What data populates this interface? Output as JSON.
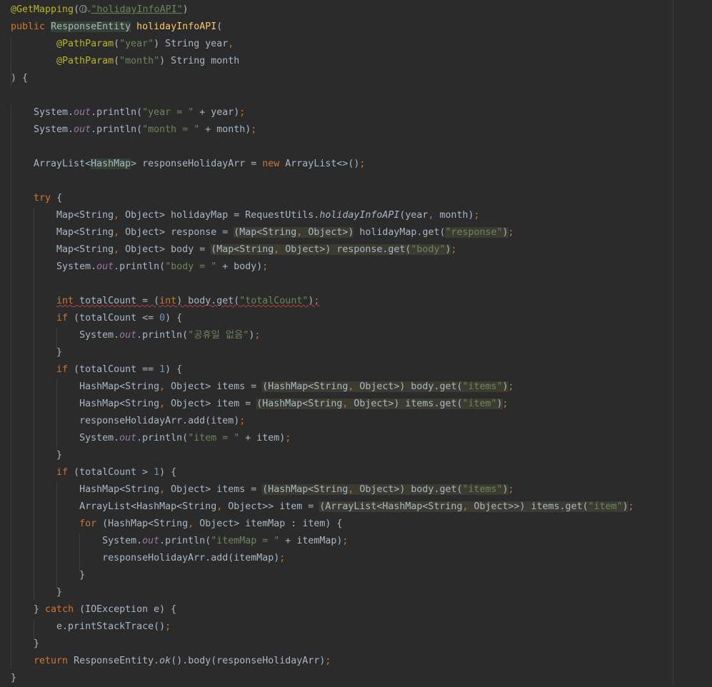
{
  "editor": {
    "lines": [
      "@GetMapping(\"holidayInfoAPI\")",
      "public ResponseEntity holidayInfoAPI(",
      "        @PathParam(\"year\") String year,",
      "        @PathParam(\"month\") String month",
      ") {",
      "",
      "    System.out.println(\"year = \" + year);",
      "    System.out.println(\"month = \" + month);",
      "",
      "    ArrayList<HashMap> responseHolidayArr = new ArrayList<>();",
      "",
      "    try {",
      "        Map<String, Object> holidayMap = RequestUtils.holidayInfoAPI(year, month);",
      "        Map<String, Object> response = (Map<String, Object>) holidayMap.get(\"response\");",
      "        Map<String, Object> body = (Map<String, Object>) response.get(\"body\");",
      "        System.out.println(\"body = \" + body);",
      "",
      "        int totalCount = (int) body.get(\"totalCount\");",
      "        if (totalCount <= 0) {",
      "            System.out.println(\"공휴일 없음\");",
      "        }",
      "        if (totalCount == 1) {",
      "            HashMap<String, Object> items = (HashMap<String, Object>) body.get(\"items\");",
      "            HashMap<String, Object> item = (HashMap<String, Object>) items.get(\"item\");",
      "            responseHolidayArr.add(item);",
      "            System.out.println(\"item = \" + item);",
      "        }",
      "        if (totalCount > 1) {",
      "            HashMap<String, Object> items = (HashMap<String, Object>) body.get(\"items\");",
      "            ArrayList<HashMap<String, Object>> item = (ArrayList<HashMap<String, Object>>) items.get(\"item\");",
      "            for (HashMap<String, Object> itemMap : item) {",
      "                System.out.println(\"itemMap = \" + itemMap);",
      "                responseHolidayArr.add(itemMap);",
      "            }",
      "        }",
      "    } catch (IOException e) {",
      "        e.printStackTrace();",
      "    }",
      "    return ResponseEntity.ok().body(responseHolidayArr);",
      "}"
    ],
    "icons": [
      "globe-icon",
      "chevron-down-icon"
    ],
    "colors": {
      "background": "#2b2b2b",
      "default": "#a9b7c6",
      "keyword": "#cc7832",
      "annotation": "#bbb529",
      "string": "#6a8759",
      "number": "#6897bb",
      "function": "#ffc66d",
      "static_field": "#9876aa",
      "cast_highlight": "#3b3b32",
      "identifier_highlight": "#344134"
    }
  }
}
